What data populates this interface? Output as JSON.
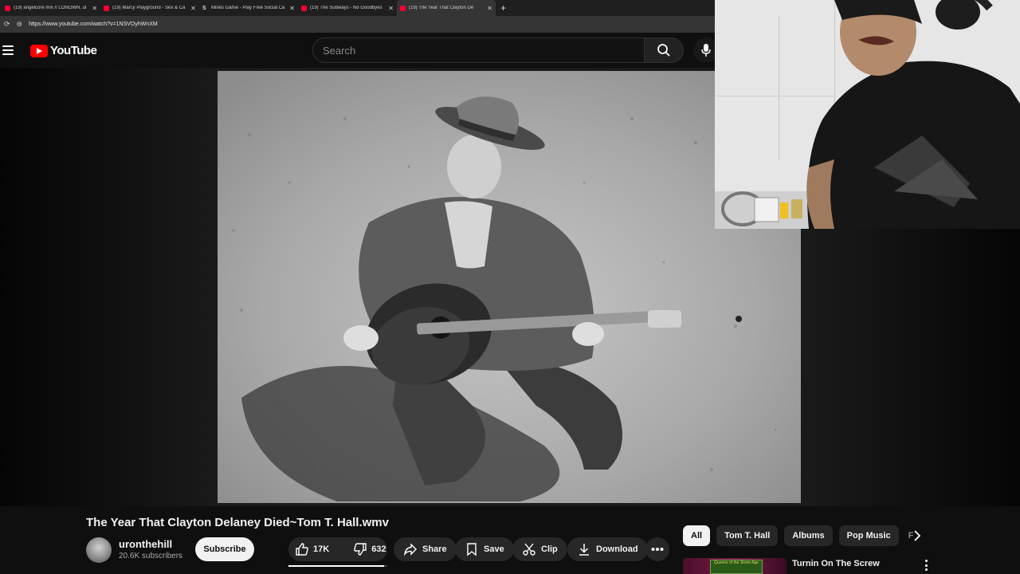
{
  "browser": {
    "tabs": [
      {
        "label": "(19) angelcore mix // LONOWN, ul",
        "icon": "youtube-favicon",
        "active": false
      },
      {
        "label": "(19) Marcy Playground - Sex & Ca",
        "icon": "youtube-favicon",
        "active": false
      },
      {
        "label": "Mines Game - Play Free Social Ca",
        "icon": "stake-favicon",
        "active": false
      },
      {
        "label": "(19) The Subways - No Goodbyes",
        "icon": "youtube-favicon",
        "active": false
      },
      {
        "label": "(19) The Year That Clayton De",
        "icon": "youtube-favicon",
        "active": true
      }
    ],
    "url": "https://www.youtube.com/watch?v=1NSVOyhWnXM"
  },
  "header": {
    "logo_text": "YouTube",
    "search_placeholder": "Search"
  },
  "video": {
    "title": "The Year That Clayton Delaney Died~Tom T. Hall.wmv",
    "channel": "uronthehill",
    "subscribers": "20.6K subscribers",
    "subscribe_label": "Subscribe",
    "likes": "17K",
    "dislikes": "632",
    "like_ratio": 0.964,
    "share_label": "Share",
    "save_label": "Save",
    "clip_label": "Clip",
    "download_label": "Download"
  },
  "chips": [
    "All",
    "Tom T. Hall",
    "Albums",
    "Pop Music",
    "F"
  ],
  "recommendation": {
    "title": "Turnin On The Screw",
    "thumb_text": "Queens of the Stone Age"
  },
  "colors": {
    "background": "#0f0f0f",
    "brand_red": "#ff0000",
    "pill": "#272727"
  }
}
